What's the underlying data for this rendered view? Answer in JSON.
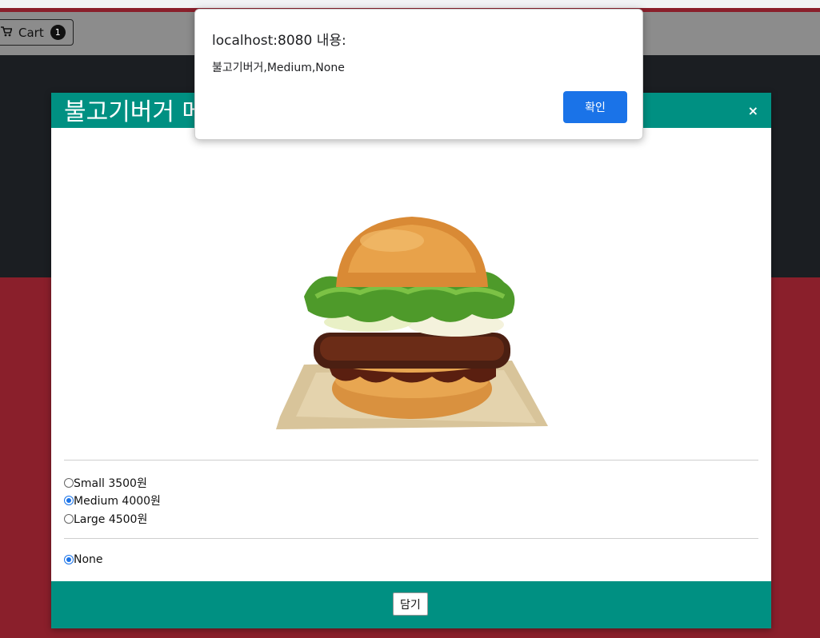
{
  "colors": {
    "nav_bg": "#8c8c8c",
    "dark_band": "#1b1e22",
    "red_band": "#8a1f2b",
    "modal_accent": "#009082",
    "alert_button": "#1a73e8"
  },
  "navbar": {
    "cart_icon": "cart-icon",
    "cart_label": "Cart",
    "cart_count": "1"
  },
  "modal": {
    "title": "불고기버거 메뉴",
    "close_label": "×",
    "image_icon": "burger-image",
    "sizes": [
      {
        "label": "Small 3500원",
        "selected": false
      },
      {
        "label": "Medium 4000원",
        "selected": true
      },
      {
        "label": "Large 4500원",
        "selected": false
      }
    ],
    "extras": [
      {
        "label": "None",
        "selected": true
      }
    ],
    "add_button": "담기"
  },
  "alert": {
    "title": "localhost:8080 내용:",
    "message": "불고기버거,Medium,None",
    "ok_label": "확인"
  }
}
